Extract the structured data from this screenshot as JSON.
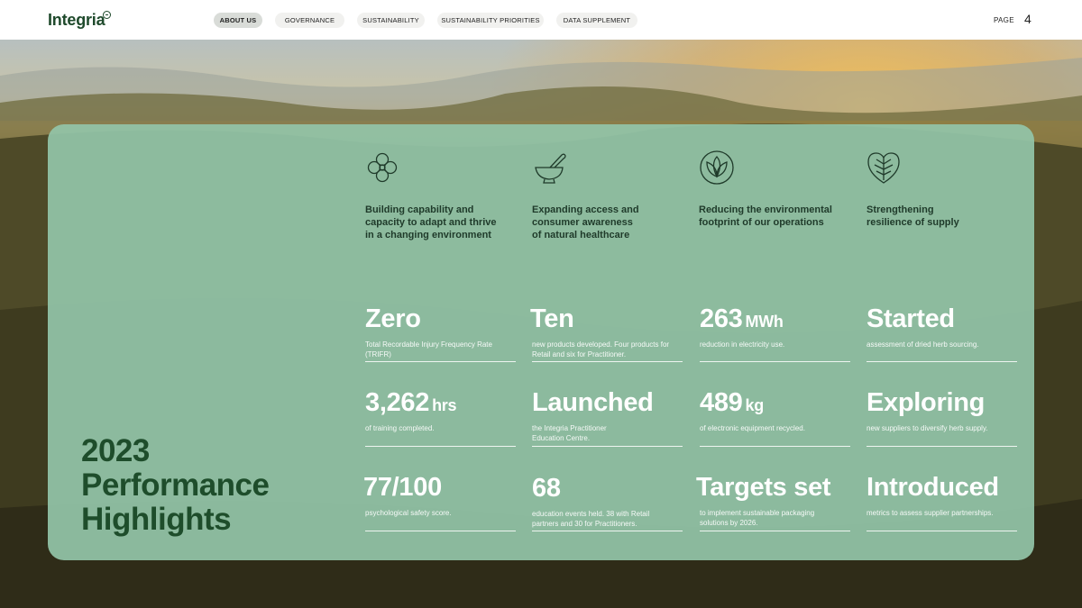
{
  "header": {
    "logo": "Integria",
    "nav": [
      {
        "label": "ABOUT US",
        "active": true
      },
      {
        "label": "GOVERNANCE",
        "active": false
      },
      {
        "label": "SUSTAINABILITY",
        "active": false
      },
      {
        "label": "SUSTAINABILITY PRIORITIES",
        "active": false
      },
      {
        "label": "DATA SUPPLEMENT",
        "active": false
      }
    ],
    "page_label": "PAGE",
    "page_number": "4"
  },
  "title": {
    "line1": "2023",
    "line2": "Performance",
    "line3": "Highlights"
  },
  "themes": [
    {
      "icon": "flower-icon",
      "text": "Building capability and capacity to adapt and thrive in a changing environment"
    },
    {
      "icon": "mortar-pestle-icon",
      "text": "Expanding access and consumer awareness of natural healthcare"
    },
    {
      "icon": "lotus-icon",
      "text": "Reducing the environmental footprint of our operations"
    },
    {
      "icon": "leaf-heart-icon",
      "text": "Strengthening resilience of supply"
    }
  ],
  "stats": [
    {
      "value": "Zero",
      "unit": "",
      "desc": "Total Recordable Injury Frequency Rate (TRIFR)"
    },
    {
      "value": "Ten",
      "unit": "",
      "desc": "new products developed. Four products for Retail and six for Practitioner."
    },
    {
      "value": "263",
      "unit": "MWh",
      "desc": "reduction in electricity use."
    },
    {
      "value": "Started",
      "unit": "",
      "desc": "assessment of dried herb sourcing."
    },
    {
      "value": "3,262",
      "unit": "hrs",
      "desc": "of training completed."
    },
    {
      "value": "Launched",
      "unit": "",
      "desc": "the Integria Practitioner Education Centre."
    },
    {
      "value": "489",
      "unit": "kg",
      "desc": "of electronic equipment recycled."
    },
    {
      "value": "Exploring",
      "unit": "",
      "desc": "new suppliers to diversify herb supply."
    },
    {
      "value": "77/100",
      "unit": "",
      "desc": "psychological safety score."
    },
    {
      "value": "68",
      "unit": "",
      "desc": "education events held. 38 with Retail partners and 30 for Practitioners."
    },
    {
      "value": "Targets set",
      "unit": "",
      "desc": "to implement sustainable packaging solutions by 2026."
    },
    {
      "value": "Introduced",
      "unit": "",
      "desc": "metrics to assess supplier partnerships."
    }
  ],
  "colors": {
    "panel": "#92c4a8",
    "title": "#1e4d2b",
    "text_dark": "#1f3a2a",
    "icon": "#1f3a2a"
  }
}
